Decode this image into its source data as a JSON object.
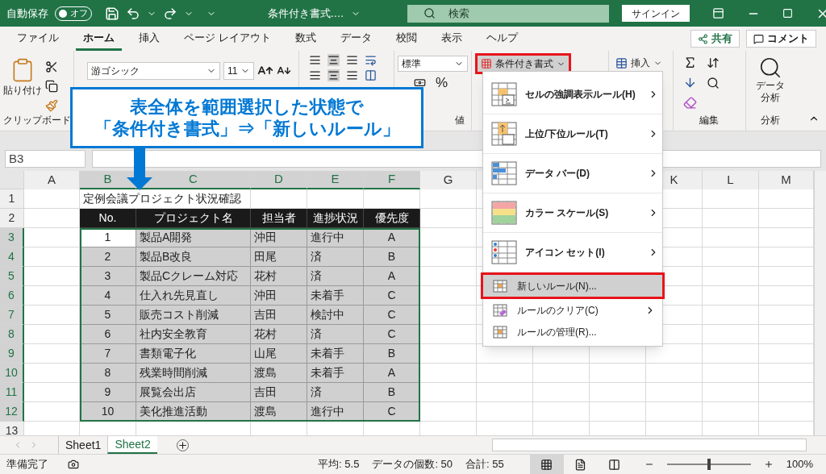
{
  "title_bar": {
    "autosave_label": "自動保存",
    "autosave_toggle": "オフ",
    "autosave_on": false,
    "doc_title": "条件付き書式.…",
    "search_placeholder": "検索",
    "signin": "サインイン"
  },
  "ribbon_tabs": [
    {
      "label": "ファイル",
      "selected": false
    },
    {
      "label": "ホーム",
      "selected": true
    },
    {
      "label": "挿入",
      "selected": false
    },
    {
      "label": "ページ レイアウト",
      "selected": false
    },
    {
      "label": "数式",
      "selected": false
    },
    {
      "label": "データ",
      "selected": false
    },
    {
      "label": "校閲",
      "selected": false
    },
    {
      "label": "表示",
      "selected": false
    },
    {
      "label": "ヘルプ",
      "selected": false
    }
  ],
  "share": "共有",
  "comments": "コメント",
  "ribbon": {
    "paste": "貼り付け",
    "clipboard_label": "クリップボード",
    "font_name": "游ゴシック",
    "font_size": "11",
    "number_format": "標準",
    "percent": "%",
    "number_label": "値",
    "cond_format": "条件付き書式",
    "insert": "挿入",
    "editing_label": "編集",
    "data_analysis": [
      "データ",
      "分析"
    ],
    "analysis_label": "分析"
  },
  "callout": [
    "表全体を範囲選択した状態で",
    "「条件付き書式」⇒「新しいルール」"
  ],
  "name_box": "B3",
  "columns": [
    {
      "label": "A",
      "selected": false
    },
    {
      "label": "B",
      "selected": true
    },
    {
      "label": "C",
      "selected": true
    },
    {
      "label": "D",
      "selected": true
    },
    {
      "label": "E",
      "selected": true
    },
    {
      "label": "F",
      "selected": true
    },
    {
      "label": "G",
      "selected": false
    },
    {
      "label": "K",
      "selected": false
    },
    {
      "label": "L",
      "selected": false
    },
    {
      "label": "M",
      "selected": false
    }
  ],
  "row_numbers": [
    {
      "label": "1",
      "selected": false
    },
    {
      "label": "2",
      "selected": false
    },
    {
      "label": "3",
      "selected": true
    },
    {
      "label": "4",
      "selected": true
    },
    {
      "label": "5",
      "selected": true
    },
    {
      "label": "6",
      "selected": true
    },
    {
      "label": "7",
      "selected": true
    },
    {
      "label": "8",
      "selected": true
    },
    {
      "label": "9",
      "selected": true
    },
    {
      "label": "10",
      "selected": true
    },
    {
      "label": "11",
      "selected": true
    },
    {
      "label": "12",
      "selected": true
    },
    {
      "label": "13",
      "selected": false
    }
  ],
  "sheet_title": "定例会議プロジェクト状況確認",
  "table_header": [
    "No.",
    "プロジェクト名",
    "担当者",
    "進捗状況",
    "優先度"
  ],
  "table_rows": [
    [
      "1",
      "製品A開発",
      "沖田",
      "進行中",
      "A"
    ],
    [
      "2",
      "製品B改良",
      "田尾",
      "済",
      "B"
    ],
    [
      "3",
      "製品Cクレーム対応",
      "花村",
      "済",
      "A"
    ],
    [
      "4",
      "仕入れ先見直し",
      "沖田",
      "未着手",
      "C"
    ],
    [
      "5",
      "販売コスト削減",
      "吉田",
      "検討中",
      "C"
    ],
    [
      "6",
      "社内安全教育",
      "花村",
      "済",
      "C"
    ],
    [
      "7",
      "書類電子化",
      "山尾",
      "未着手",
      "B"
    ],
    [
      "8",
      "残業時間削減",
      "渡島",
      "未着手",
      "A"
    ],
    [
      "9",
      "展覧会出店",
      "吉田",
      "済",
      "B"
    ],
    [
      "10",
      "美化推進活動",
      "渡島",
      "進行中",
      "C"
    ]
  ],
  "menu": [
    {
      "kind": "big",
      "label": "セルの強調表示ルール(H)",
      "submenu": true,
      "selected": false
    },
    {
      "kind": "big",
      "label": "上位/下位ルール(T)",
      "submenu": true,
      "selected": false
    },
    {
      "kind": "big",
      "label": "データ バー(D)",
      "submenu": true,
      "selected": false
    },
    {
      "kind": "big",
      "label": "カラー スケール(S)",
      "submenu": true,
      "selected": false
    },
    {
      "kind": "big",
      "label": "アイコン セット(I)",
      "submenu": true,
      "selected": false
    },
    {
      "kind": "small",
      "label": "新しいルール(N)...",
      "submenu": false,
      "selected": true
    },
    {
      "kind": "small",
      "label": "ルールのクリア(C)",
      "submenu": true,
      "selected": false
    },
    {
      "kind": "small",
      "label": "ルールの管理(R)...",
      "submenu": false,
      "selected": false
    }
  ],
  "sheets": [
    {
      "label": "Sheet1",
      "selected": false
    },
    {
      "label": "Sheet2",
      "selected": true
    }
  ],
  "status_bar": {
    "ready": "準備完了",
    "stats": [
      "平均: 5.5",
      "データの個数: 50",
      "合計: 55"
    ],
    "views": [
      {
        "kind": "normal",
        "selected": true
      },
      {
        "kind": "layout",
        "selected": false
      },
      {
        "kind": "pagebreak",
        "selected": false
      }
    ],
    "zoom": {
      "level": 0.5,
      "reading": "100%"
    }
  }
}
